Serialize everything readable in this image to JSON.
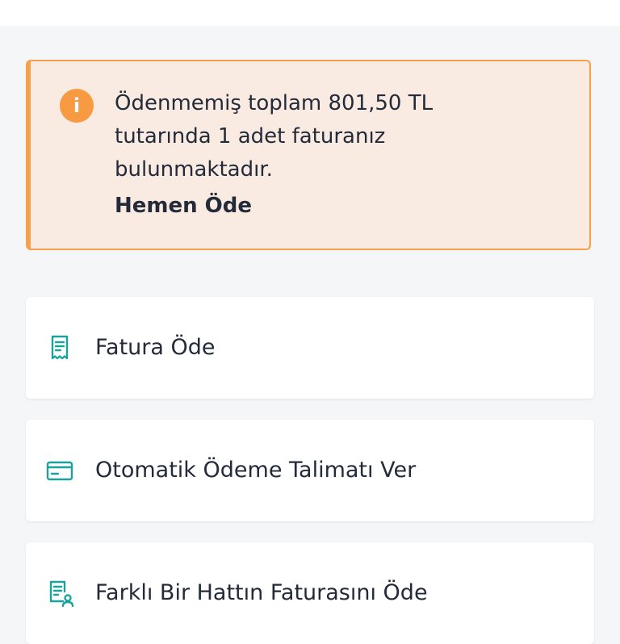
{
  "alert": {
    "icon": "info-icon",
    "icon_glyph": "i",
    "message": "Ödenmemiş toplam 801,50 TL tutarında 1 adet faturanız bulunmaktadır.",
    "action_label": "Hemen Öde",
    "accent_color": "#f5a04e",
    "background_color": "#f9ebe2"
  },
  "menu": {
    "items": [
      {
        "label": "Fatura Öde",
        "icon": "receipt-icon"
      },
      {
        "label": "Otomatik Ödeme Talimatı Ver",
        "icon": "credit-card-icon"
      },
      {
        "label": "Farklı Bir Hattın Faturasını Öde",
        "icon": "invoice-user-icon"
      }
    ],
    "icon_color": "#1aa39a"
  }
}
